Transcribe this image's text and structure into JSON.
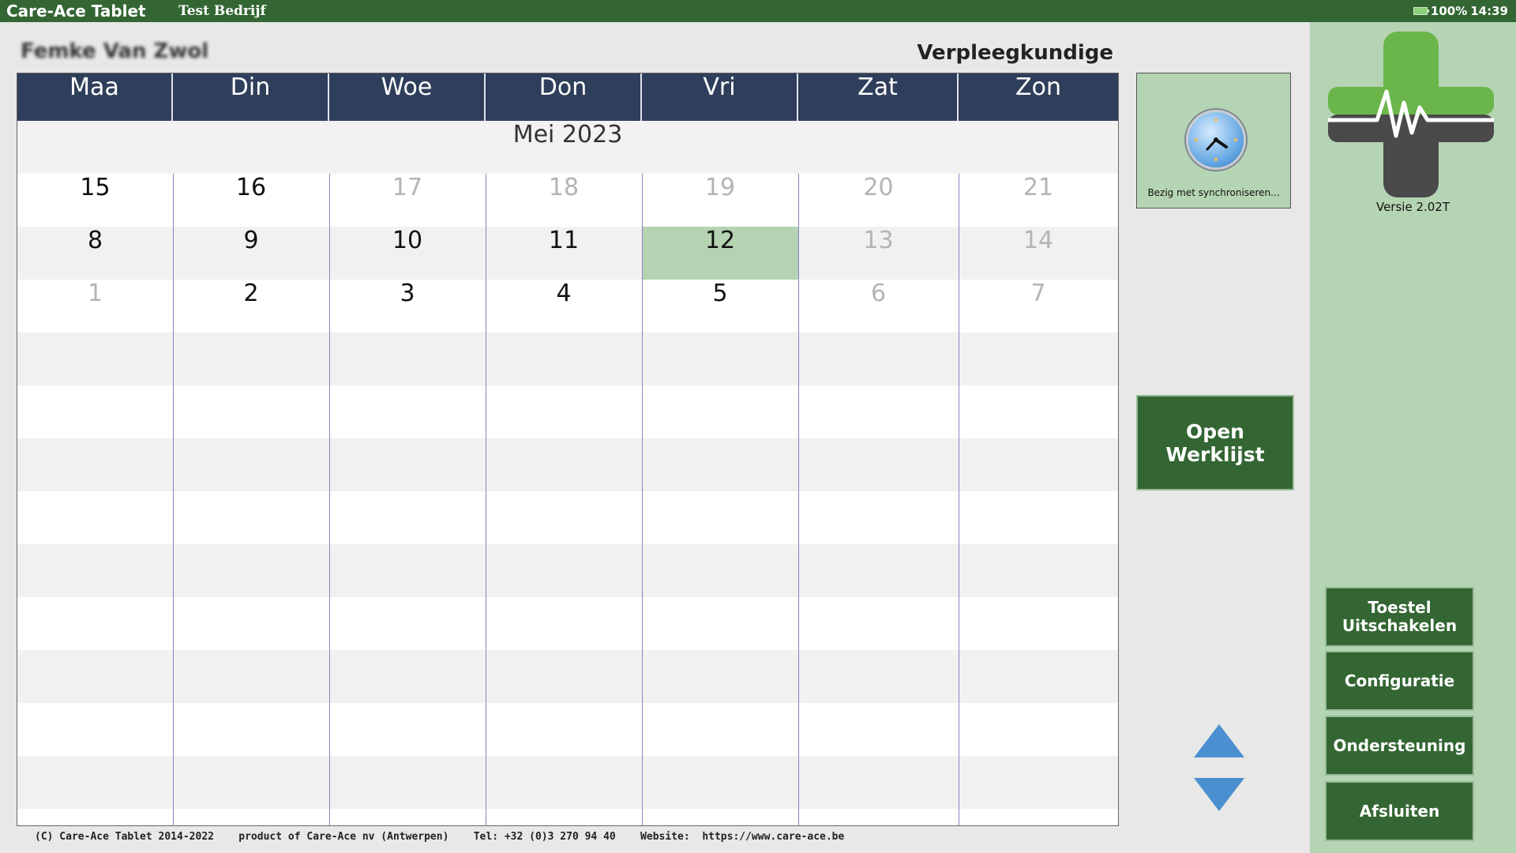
{
  "topbar": {
    "app_title": "Care-Ace Tablet",
    "company": "Test Bedrijf",
    "battery": "100%",
    "time": "14:39"
  },
  "user": {
    "name": "Femke Van Zwol",
    "role": "Verpleegkundige"
  },
  "calendar": {
    "days": [
      "Maa",
      "Din",
      "Woe",
      "Don",
      "Vri",
      "Zat",
      "Zon"
    ],
    "month": "Mei 2023",
    "weeks": [
      [
        "15",
        "16",
        "17",
        "18",
        "19",
        "20",
        "21"
      ],
      [
        "8",
        "9",
        "10",
        "11",
        "12",
        "13",
        "14"
      ],
      [
        "1",
        "2",
        "3",
        "4",
        "5",
        "6",
        "7"
      ]
    ]
  },
  "sync": {
    "label": "Bezig met synchroniseren..."
  },
  "actions": {
    "open_worklist": "Open Werklijst",
    "shutdown": "Toestel Uitschakelen",
    "configuration": "Configuratie",
    "support": "Ondersteuning",
    "close": "Afsluiten"
  },
  "version": "Versie 2.02T",
  "footer": {
    "copyright": "(C) Care-Ace Tablet 2014-2022",
    "product": "product of Care-Ace nv (Antwerpen)",
    "tel": "Tel: +32 (0)3 270 94 40",
    "website": "Website:  https://www.care-ace.be"
  },
  "colors": {
    "topbar": "#336633",
    "header": "#2f3e5a",
    "panel": "#b5d4b3",
    "button": "#336633",
    "today": "#b5d3b2",
    "arrows": "#4a8fd0"
  }
}
